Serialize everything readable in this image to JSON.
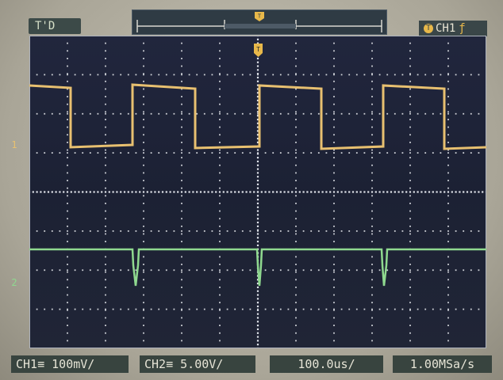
{
  "status": {
    "label": "T'D"
  },
  "trigger": {
    "icon": "T",
    "channel": "CH1",
    "edge": "ƒ"
  },
  "markers": {
    "ch1": "1",
    "ch2": "2"
  },
  "bottom": {
    "ch1": "CH1≡ 100mV/",
    "ch2": "CH2≡ 5.00V/",
    "timebase": "100.0us/",
    "sample_rate": "1.00MSa/s"
  },
  "colors": {
    "ch1": "#e8c070",
    "ch2": "#8fd98f",
    "trigger": "#e8b84a",
    "screen": "#1f2438"
  },
  "icons": [
    "trigger-position-icon",
    "trigger-edge-icon"
  ]
}
